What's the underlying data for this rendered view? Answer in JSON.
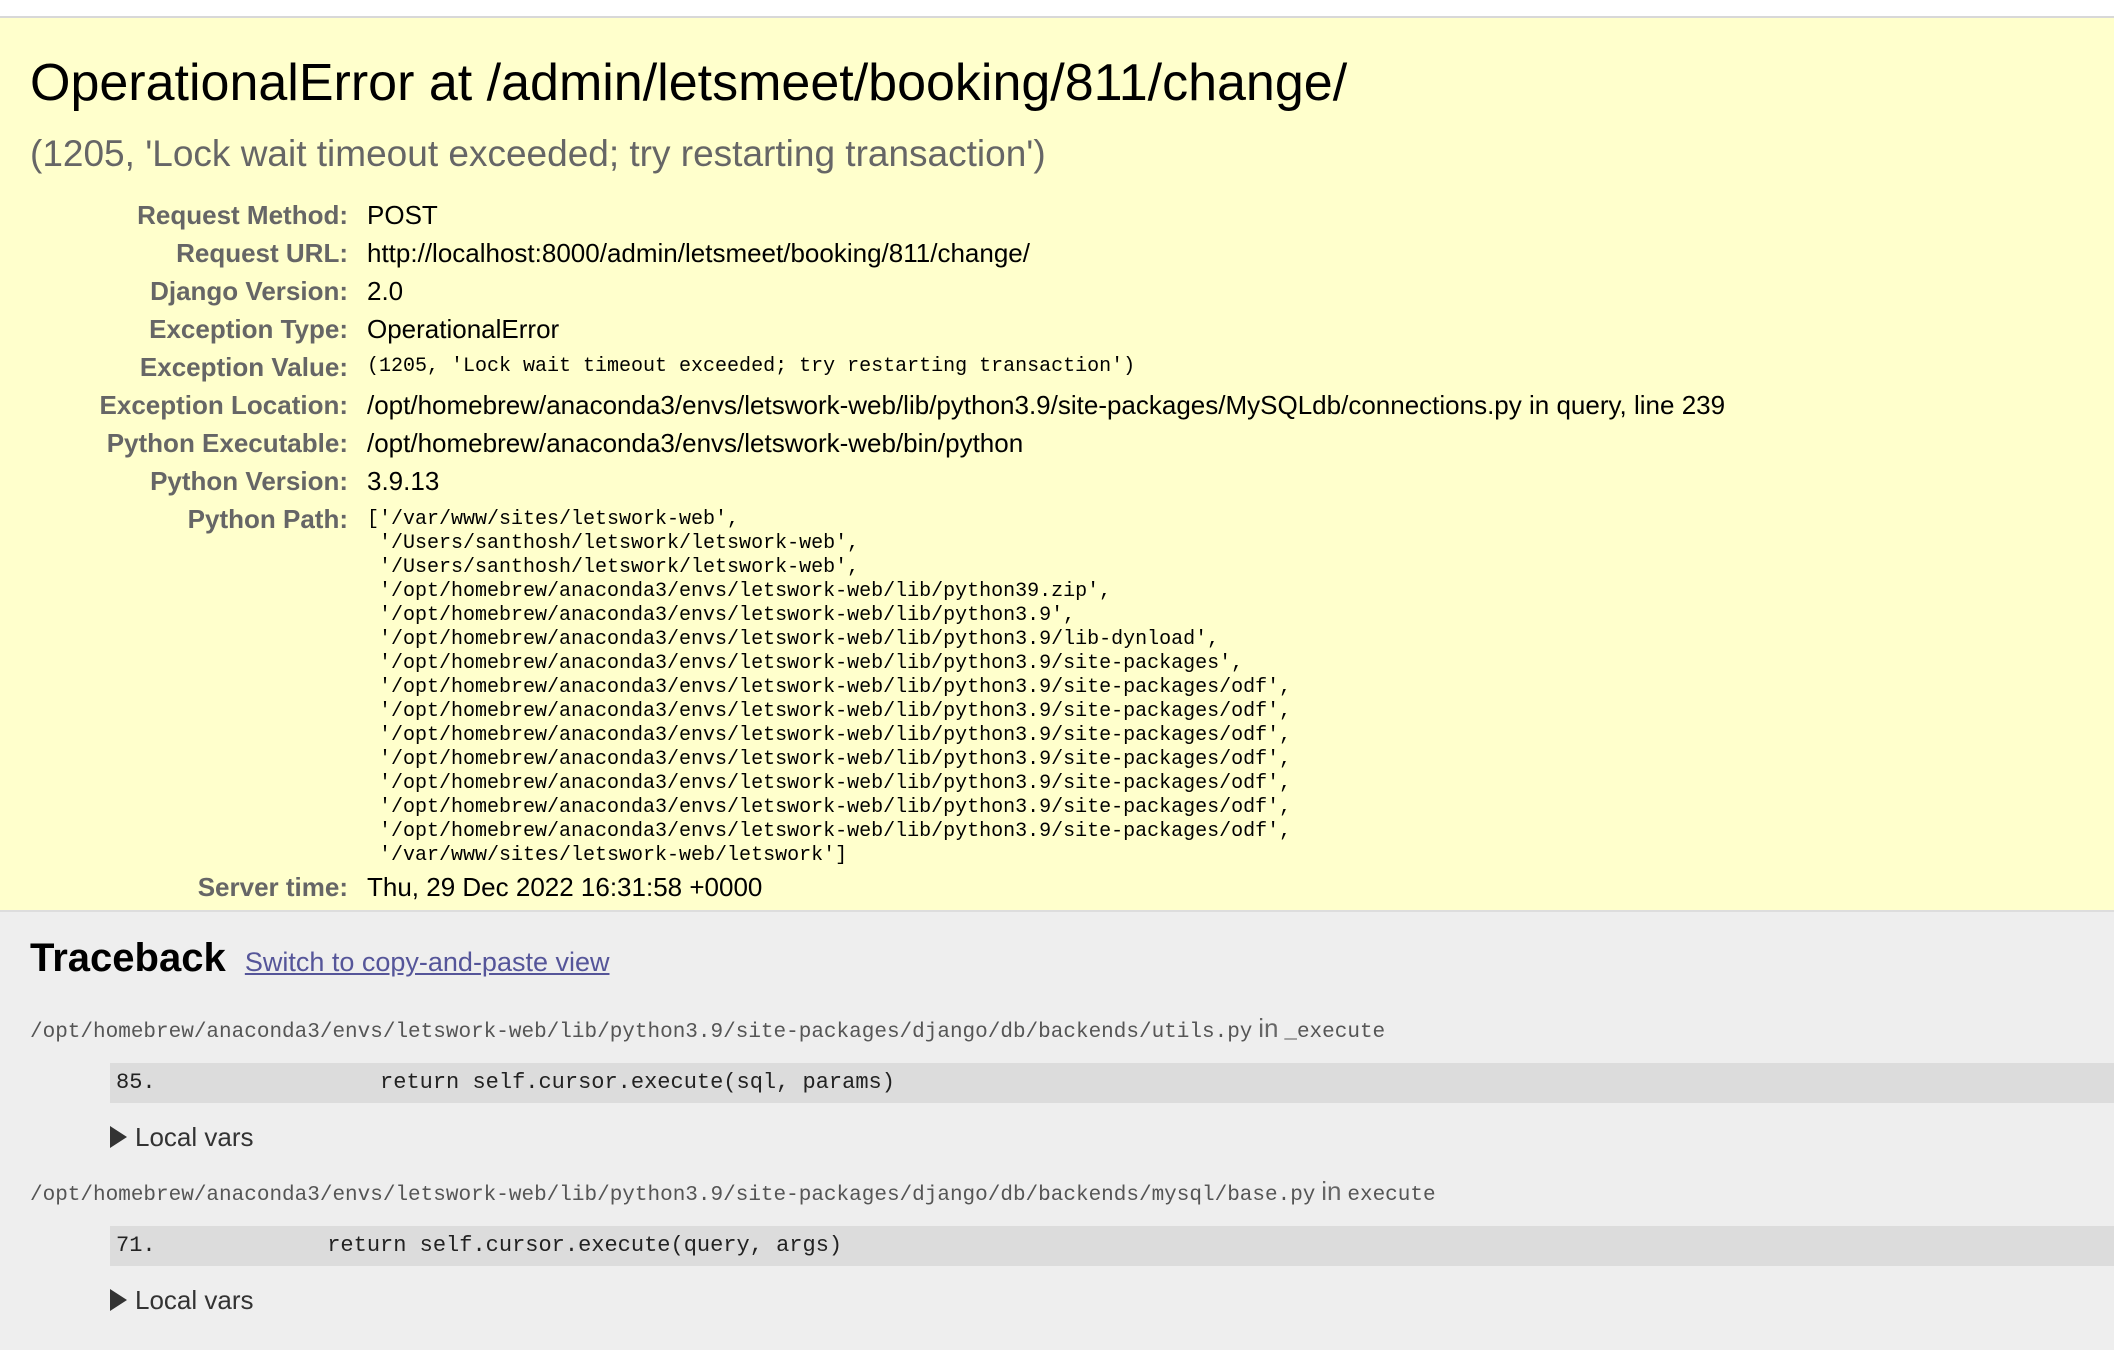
{
  "error": {
    "title": "OperationalError at /admin/letsmeet/booking/811/change/",
    "message": "(1205, 'Lock wait timeout exceeded; try restarting transaction')"
  },
  "meta": [
    {
      "key": "Request Method:",
      "value": "POST"
    },
    {
      "key": "Request URL:",
      "value": "http://localhost:8000/admin/letsmeet/booking/811/change/"
    },
    {
      "key": "Django Version:",
      "value": "2.0"
    },
    {
      "key": "Exception Type:",
      "value": "OperationalError"
    },
    {
      "key": "Exception Value:",
      "value": "(1205, 'Lock wait timeout exceeded; try restarting transaction')"
    },
    {
      "key": "Exception Location:",
      "value": "/opt/homebrew/anaconda3/envs/letswork-web/lib/python3.9/site-packages/MySQLdb/connections.py in query, line 239"
    },
    {
      "key": "Python Executable:",
      "value": "/opt/homebrew/anaconda3/envs/letswork-web/bin/python"
    },
    {
      "key": "Python Version:",
      "value": "3.9.13"
    },
    {
      "key": "Python Path:",
      "value": "['/var/www/sites/letswork-web',\n '/Users/santhosh/letswork/letswork-web',\n '/Users/santhosh/letswork/letswork-web',\n '/opt/homebrew/anaconda3/envs/letswork-web/lib/python39.zip',\n '/opt/homebrew/anaconda3/envs/letswork-web/lib/python3.9',\n '/opt/homebrew/anaconda3/envs/letswork-web/lib/python3.9/lib-dynload',\n '/opt/homebrew/anaconda3/envs/letswork-web/lib/python3.9/site-packages',\n '/opt/homebrew/anaconda3/envs/letswork-web/lib/python3.9/site-packages/odf',\n '/opt/homebrew/anaconda3/envs/letswork-web/lib/python3.9/site-packages/odf',\n '/opt/homebrew/anaconda3/envs/letswork-web/lib/python3.9/site-packages/odf',\n '/opt/homebrew/anaconda3/envs/letswork-web/lib/python3.9/site-packages/odf',\n '/opt/homebrew/anaconda3/envs/letswork-web/lib/python3.9/site-packages/odf',\n '/opt/homebrew/anaconda3/envs/letswork-web/lib/python3.9/site-packages/odf',\n '/opt/homebrew/anaconda3/envs/letswork-web/lib/python3.9/site-packages/odf',\n '/var/www/sites/letswork-web/letswork']"
    },
    {
      "key": "Server time:",
      "value": "Thu, 29 Dec 2022 16:31:58 +0000"
    }
  ],
  "traceback": {
    "heading": "Traceback",
    "switch_link": "Switch to copy-and-paste view",
    "frames": [
      {
        "file": "/opt/homebrew/anaconda3/envs/letswork-web/lib/python3.9/site-packages/django/db/backends/utils.py",
        "in_word": "in",
        "function": "_execute",
        "code": "85.                 return self.cursor.execute(sql, params)",
        "local_vars": "Local vars"
      },
      {
        "file": "/opt/homebrew/anaconda3/envs/letswork-web/lib/python3.9/site-packages/django/db/backends/mysql/base.py",
        "in_word": "in",
        "function": "execute",
        "code": "71.             return self.cursor.execute(query, args)",
        "local_vars": "Local vars"
      }
    ]
  },
  "colors": {
    "summary_bg": "#ffffcc",
    "page_bg": "#eeeeee",
    "label_gray": "#666666",
    "link": "#555599",
    "code_bg": "#dcdcdc"
  }
}
